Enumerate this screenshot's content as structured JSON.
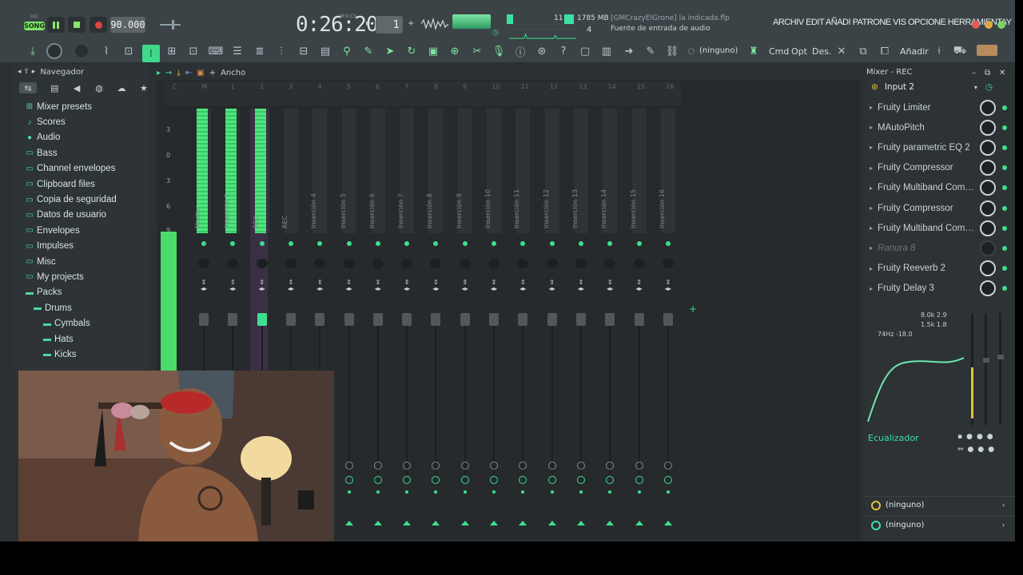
{
  "transport": {
    "pat_label": "PAT",
    "song_label": "SONG",
    "tempo": "90.000",
    "time": "0:26:20",
    "time_unit": "M:S:CS",
    "pattern": "1"
  },
  "status": {
    "cpu_value": "11",
    "memory": "1785 MB",
    "poly": "4",
    "project_hint": "[GMCrazyElGrone] la indicada.flp",
    "hint_line": "Fuente de entrada de audio"
  },
  "menu": {
    "text": "ARCHIV EDIT AÑADI PATRONE VIS OPCIONE HERRAMIENTAY"
  },
  "toolbar": {
    "none_label": "(ninguno)",
    "cmd": "Cmd",
    "opt": "Opt",
    "des": "Des.",
    "add": "Añadir"
  },
  "browser": {
    "title": "Navegador",
    "items": [
      {
        "label": "Mixer presets",
        "icon": "preset-icon",
        "level": 0
      },
      {
        "label": "Scores",
        "icon": "note-icon",
        "level": 0
      },
      {
        "label": "Audio",
        "icon": "user-icon",
        "level": 0
      },
      {
        "label": "Bass",
        "icon": "folder-icon",
        "level": 0
      },
      {
        "label": "Channel envelopes",
        "icon": "folder-icon",
        "level": 0
      },
      {
        "label": "Clipboard files",
        "icon": "folder-icon",
        "level": 0
      },
      {
        "label": "Copia de seguridad",
        "icon": "folder-icon",
        "level": 0
      },
      {
        "label": "Datos de usuario",
        "icon": "folder-icon",
        "level": 0
      },
      {
        "label": "Envelopes",
        "icon": "folder-icon",
        "level": 0
      },
      {
        "label": "Impulses",
        "icon": "folder-icon",
        "level": 0
      },
      {
        "label": "Misc",
        "icon": "folder-icon",
        "level": 0
      },
      {
        "label": "My projects",
        "icon": "folder-icon",
        "level": 0
      },
      {
        "label": "Packs",
        "icon": "folder-open-icon",
        "level": 0
      },
      {
        "label": "Drums",
        "icon": "folder-open-icon",
        "level": 1
      },
      {
        "label": "Cymbals",
        "icon": "folder-open-icon",
        "level": 2
      },
      {
        "label": "Hats",
        "icon": "folder-open-icon",
        "level": 2
      },
      {
        "label": "Kicks",
        "icon": "folder-open-icon",
        "level": 2
      }
    ]
  },
  "mixer": {
    "header_label": "Ancho",
    "ruler": [
      "C",
      "M",
      "1",
      "2",
      "3",
      "4",
      "5",
      "6",
      "7",
      "8",
      "9",
      "10",
      "11",
      "12",
      "13",
      "14",
      "15",
      "16"
    ],
    "db_scale": [
      "3",
      "0",
      "3",
      "6",
      "9"
    ],
    "strips": [
      {
        "name": "Master",
        "level": 1.0,
        "active": true
      },
      {
        "name": "Inserción 1",
        "level": 1.0,
        "active": true
      },
      {
        "name": "REC",
        "level": 1.0,
        "active": true,
        "selected": true
      },
      {
        "name": "REC",
        "level": 0.0
      },
      {
        "name": "Inserción 4",
        "level": 0.0
      },
      {
        "name": "Inserción 5",
        "level": 0.0
      },
      {
        "name": "Inserción 6",
        "level": 0.0
      },
      {
        "name": "Inserción 7",
        "level": 0.0
      },
      {
        "name": "Inserción 8",
        "level": 0.0
      },
      {
        "name": "Inserción 9",
        "level": 0.0
      },
      {
        "name": "Inserción 10",
        "level": 0.0
      },
      {
        "name": "Inserción 11",
        "level": 0.0
      },
      {
        "name": "Inserción 12",
        "level": 0.0
      },
      {
        "name": "Inserción 13",
        "level": 0.0
      },
      {
        "name": "Inserción 14",
        "level": 0.0
      },
      {
        "name": "Inserción 15",
        "level": 0.0
      },
      {
        "name": "Inserción 16",
        "level": 0.0
      }
    ]
  },
  "panel": {
    "title": "Mixer - REC",
    "input": "Input 2",
    "slots": [
      {
        "name": "Fruity Limiter",
        "dim": false
      },
      {
        "name": "MAutoPitch",
        "dim": false
      },
      {
        "name": "Fruity parametric EQ 2",
        "dim": false
      },
      {
        "name": "Fruity Compressor",
        "dim": false
      },
      {
        "name": "Fruity Multiband Compr...",
        "dim": false
      },
      {
        "name": "Fruity Compressor",
        "dim": false
      },
      {
        "name": "Fruity Multiband Compr...",
        "dim": false
      },
      {
        "name": "Ranura 8",
        "dim": true
      },
      {
        "name": "Fruity Reeverb 2",
        "dim": false
      },
      {
        "name": "Fruity Delay 3",
        "dim": false
      }
    ],
    "eq_readout_1": "8.0k 2.9",
    "eq_readout_2": "1.5k 1.8",
    "eq_readout_3": "74Hz -18.0",
    "eq_label": "Ecualizador",
    "route_out": "(ninguno)",
    "route_in": "(ninguno)"
  },
  "colors": {
    "accent": "#3ddf8f",
    "meter": "#4ee87e",
    "record": "#e0453f"
  }
}
